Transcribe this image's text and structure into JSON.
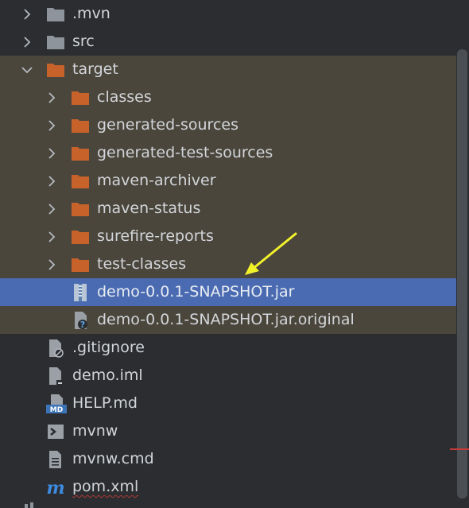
{
  "tree": {
    "items": [
      {
        "label": ".mvn",
        "icon": "folder-icon",
        "expandable": true,
        "expanded": false,
        "depth": 0
      },
      {
        "label": "src",
        "icon": "folder-icon",
        "expandable": true,
        "expanded": false,
        "depth": 0
      },
      {
        "label": "target",
        "icon": "excluded-folder-icon",
        "expandable": true,
        "expanded": true,
        "depth": 0
      },
      {
        "label": "classes",
        "icon": "excluded-folder-icon",
        "expandable": true,
        "expanded": false,
        "depth": 1
      },
      {
        "label": "generated-sources",
        "icon": "excluded-folder-icon",
        "expandable": true,
        "expanded": false,
        "depth": 1
      },
      {
        "label": "generated-test-sources",
        "icon": "excluded-folder-icon",
        "expandable": true,
        "expanded": false,
        "depth": 1
      },
      {
        "label": "maven-archiver",
        "icon": "excluded-folder-icon",
        "expandable": true,
        "expanded": false,
        "depth": 1
      },
      {
        "label": "maven-status",
        "icon": "excluded-folder-icon",
        "expandable": true,
        "expanded": false,
        "depth": 1
      },
      {
        "label": "surefire-reports",
        "icon": "excluded-folder-icon",
        "expandable": true,
        "expanded": false,
        "depth": 1
      },
      {
        "label": "test-classes",
        "icon": "excluded-folder-icon",
        "expandable": true,
        "expanded": false,
        "depth": 1
      },
      {
        "label": "demo-0.0.1-SNAPSHOT.jar",
        "icon": "jar-archive-icon",
        "expandable": false,
        "selected": true,
        "depth": 1
      },
      {
        "label": "demo-0.0.1-SNAPSHOT.jar.original",
        "icon": "unknown-file-icon",
        "expandable": false,
        "depth": 1
      },
      {
        "label": ".gitignore",
        "icon": "ignore-file-icon",
        "expandable": false,
        "depth": 0
      },
      {
        "label": "demo.iml",
        "icon": "module-file-icon",
        "expandable": false,
        "depth": 0
      },
      {
        "label": "HELP.md",
        "icon": "markdown-file-icon",
        "expandable": false,
        "depth": 0
      },
      {
        "label": "mvnw",
        "icon": "shell-script-icon",
        "expandable": false,
        "depth": 0
      },
      {
        "label": "mvnw.cmd",
        "icon": "text-file-icon",
        "expandable": false,
        "depth": 0
      },
      {
        "label": "pom.xml",
        "icon": "maven-pom-icon",
        "expandable": false,
        "depth": 0,
        "has_error_underline": true
      }
    ]
  },
  "colors": {
    "background": "#2b2d30",
    "excluded_band": "#4a463c",
    "selection": "#4a6bb2",
    "folder_grey": "#8e949b",
    "folder_excluded": "#c7622a",
    "annotation_arrow": "#f2f22a",
    "maven_blue": "#3d8be0",
    "error_red": "#c23a3a"
  },
  "annotation": {
    "icon": "yellow-arrow-annotation",
    "points_to": "demo-0.0.1-SNAPSHOT.jar"
  }
}
